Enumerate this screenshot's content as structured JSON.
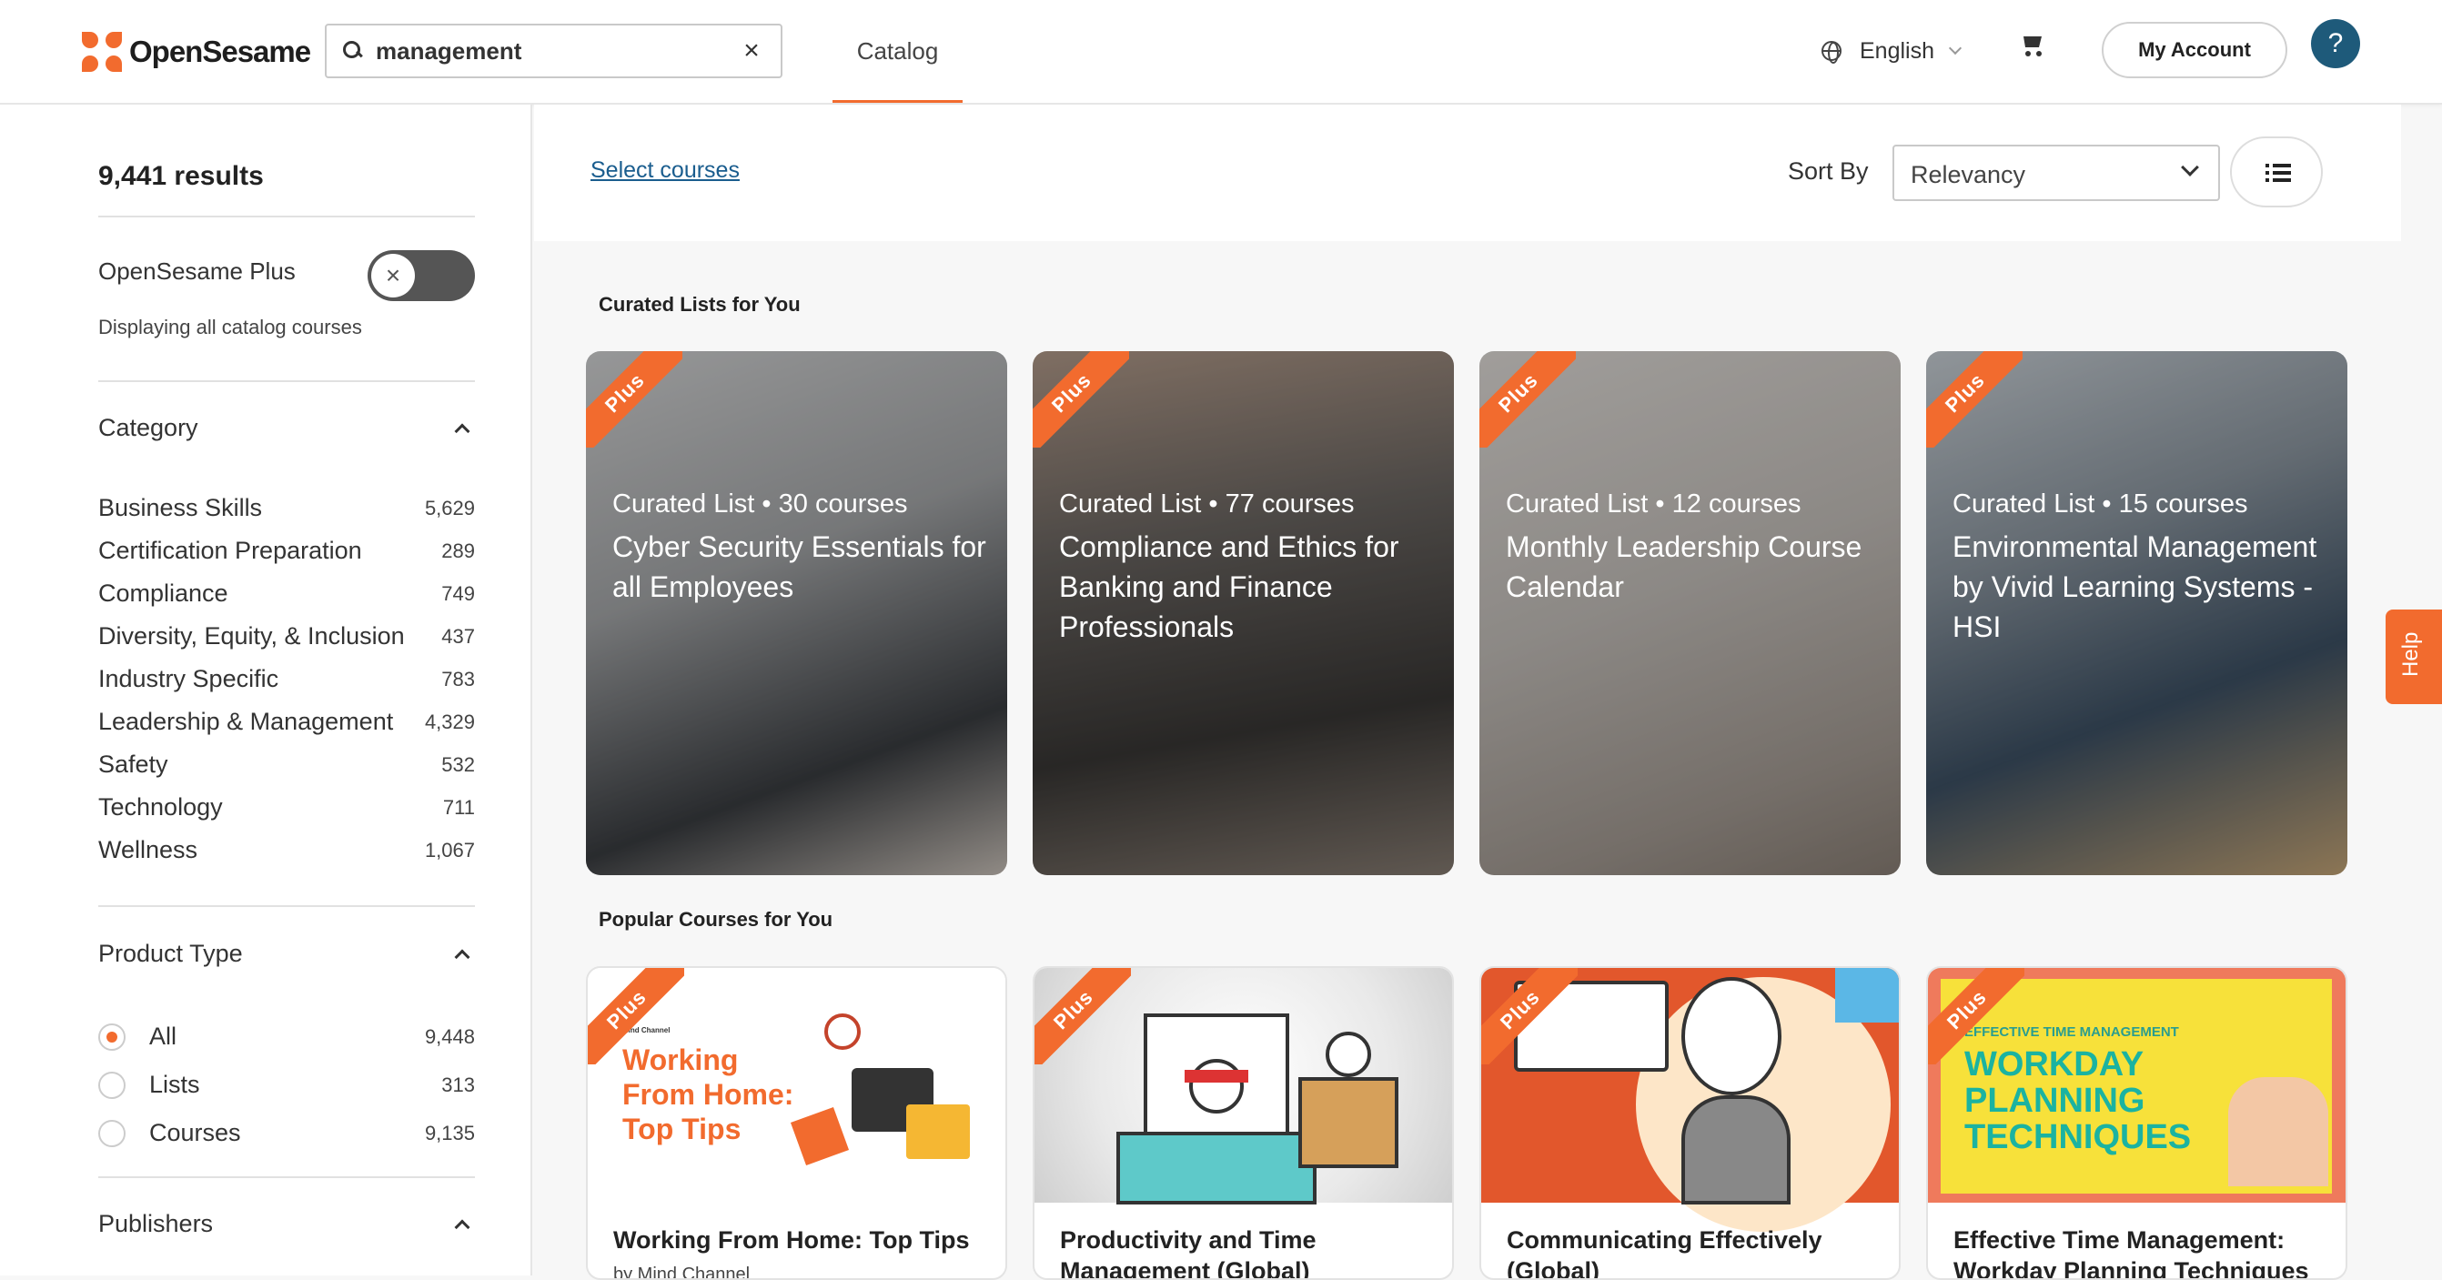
{
  "header": {
    "logo_text": "OpenSesame",
    "search_value": "management",
    "nav_catalog": "Catalog",
    "language": "English",
    "account_label": "My Account",
    "help_glyph": "?"
  },
  "sidebar": {
    "results": "9,441 results",
    "plus_label": "OpenSesame Plus",
    "plus_toggle_on": false,
    "plus_sub": "Displaying all catalog courses",
    "category_title": "Category",
    "categories": [
      {
        "label": "Business Skills",
        "count": "5,629"
      },
      {
        "label": "Certification Preparation",
        "count": "289"
      },
      {
        "label": "Compliance",
        "count": "749"
      },
      {
        "label": "Diversity, Equity, & Inclusion",
        "count": "437"
      },
      {
        "label": "Industry Specific",
        "count": "783"
      },
      {
        "label": "Leadership & Management",
        "count": "4,329"
      },
      {
        "label": "Safety",
        "count": "532"
      },
      {
        "label": "Technology",
        "count": "711"
      },
      {
        "label": "Wellness",
        "count": "1,067"
      }
    ],
    "product_type_title": "Product Type",
    "product_types": [
      {
        "label": "All",
        "count": "9,448",
        "checked": true
      },
      {
        "label": "Lists",
        "count": "313",
        "checked": false
      },
      {
        "label": "Courses",
        "count": "9,135",
        "checked": false
      }
    ],
    "publishers_title": "Publishers"
  },
  "toolbar": {
    "select_courses": "Select courses",
    "sort_by": "Sort By",
    "sort_value": "Relevancy"
  },
  "curated": {
    "title": "Curated Lists for You",
    "ribbon": "Plus",
    "items": [
      {
        "meta": "Curated List • 30 courses",
        "title": "Cyber Security Essentials for all Employees"
      },
      {
        "meta": "Curated List • 77 courses",
        "title": "Compliance and Ethics for Banking and Finance Professionals"
      },
      {
        "meta": "Curated List • 12 courses",
        "title": "Monthly Leadership Course Calendar"
      },
      {
        "meta": "Curated List • 15 courses",
        "title": "Environmental Management by Vivid Learning Systems - HSI"
      }
    ]
  },
  "popular": {
    "title": "Popular Courses for You",
    "items": [
      {
        "title": "Working From Home: Top Tips",
        "sub": "by Mind Channel",
        "img_text": "Working From Home: Top Tips",
        "img_brand": "Mind Channel"
      },
      {
        "title": "Productivity and Time Management (Global)"
      },
      {
        "title": "Communicating Effectively (Global)"
      },
      {
        "title": "Effective Time Management: Workday Planning Techniques",
        "img_kicker": "EFFECTIVE TIME MANAGEMENT",
        "img_text": "WORKDAY PLANNING TECHNIQUES"
      }
    ]
  },
  "side_help": "Help",
  "colors": {
    "accent": "#f26b2e",
    "link": "#1a5d8e",
    "help_circle": "#1e5a7a"
  }
}
